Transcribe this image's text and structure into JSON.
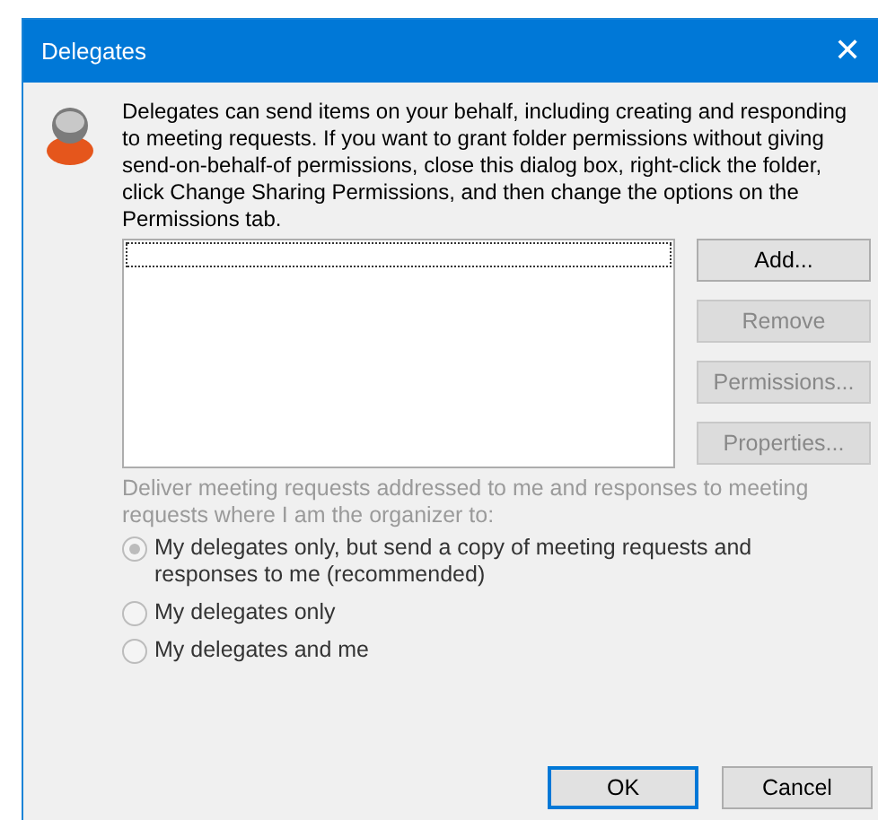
{
  "window": {
    "title": "Delegates",
    "close": "✕"
  },
  "description": "Delegates can send items on your behalf, including creating and responding to meeting requests. If you want to grant folder permissions without giving send-on-behalf-of permissions, close this dialog box, right-click the folder, click Change Sharing Permissions, and then change the options on the Permissions tab.",
  "side_buttons": [
    {
      "label": "Add...",
      "disabled": false
    },
    {
      "label": "Remove",
      "disabled": true
    },
    {
      "label": "Permissions...",
      "disabled": true
    },
    {
      "label": "Properties...",
      "disabled": true
    }
  ],
  "delivery": {
    "prompt": "Deliver meeting requests addressed to me and responses to meeting requests where I am the organizer to:",
    "disabled": true,
    "options": [
      {
        "label": "My delegates only, but send a copy of meeting requests and responses to me (recommended)",
        "selected": true,
        "disabled": true
      },
      {
        "label": "My delegates only",
        "selected": false,
        "disabled": true
      },
      {
        "label": "My delegates and me",
        "selected": false,
        "disabled": true
      }
    ]
  },
  "footer_buttons": [
    {
      "label": "OK",
      "default": true
    },
    {
      "label": "Cancel",
      "default": false
    }
  ]
}
